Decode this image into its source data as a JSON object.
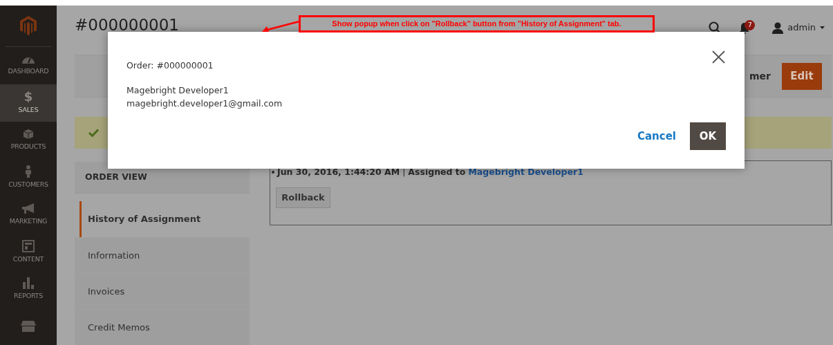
{
  "sidebar": {
    "items": [
      {
        "kind": "logo"
      },
      {
        "kind": "dashboard",
        "label": "DASHBOARD",
        "selected": false
      },
      {
        "kind": "sales",
        "label": "SALES",
        "selected": true,
        "glyph": "$"
      },
      {
        "kind": "products",
        "label": "PRODUCTS",
        "selected": false
      },
      {
        "kind": "customers",
        "label": "CUSTOMERS",
        "selected": false
      },
      {
        "kind": "marketing",
        "label": "MARKETING",
        "selected": false
      },
      {
        "kind": "content",
        "label": "CONTENT",
        "selected": false
      },
      {
        "kind": "reports",
        "label": "REPORTS",
        "selected": false
      },
      {
        "kind": "stores",
        "selected": false
      }
    ]
  },
  "header": {
    "title": "#000000001",
    "notifications": "7",
    "user": "admin"
  },
  "toolbar": {
    "partial_button": "mer",
    "edit_button": "Edit"
  },
  "tabs": {
    "heading": "ORDER VIEW",
    "items": [
      {
        "label": "History of Assignment",
        "selected": true
      },
      {
        "label": "Information",
        "selected": false
      },
      {
        "label": "Invoices",
        "selected": false
      },
      {
        "label": "Credit Memos",
        "selected": false
      }
    ]
  },
  "history": {
    "date": "Jun 30, 2016, 1:44:20 AM",
    "separator": "|",
    "action": "Assigned to",
    "assignee": "Magebright Developer1",
    "button": "Rollback"
  },
  "modal": {
    "order": "Order: #000000001",
    "name": "Magebright Developer1",
    "email": "magebright.developer1@gmail.com",
    "cancel": "Cancel",
    "ok": "OK"
  },
  "annotation": {
    "text": "Show popup when click on \"Rollback\" button from \"History of Assignment\" tab."
  }
}
